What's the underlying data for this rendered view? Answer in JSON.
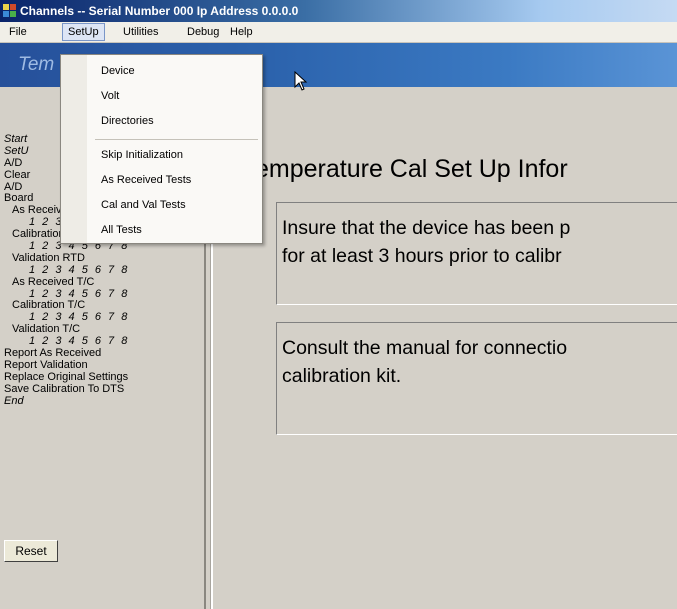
{
  "window": {
    "title": "Channels -- Serial Number 000  Ip Address 0.0.0.0"
  },
  "menubar": {
    "items": [
      "File",
      "SetUp",
      "Utilities",
      "Debug",
      "Help"
    ],
    "active": "SetUp"
  },
  "setup_menu": {
    "items": [
      "Device",
      "Volt",
      "Directories",
      "Skip Initialization",
      "As Received Tests",
      "Cal and Val Tests",
      "All Tests"
    ]
  },
  "banner": {
    "text": "Tem"
  },
  "sidebar": {
    "items": [
      "Start",
      "SetU",
      "A/D",
      "Clear",
      "A/D",
      "Board",
      "As Received RTD",
      "1 2 3 4 5 6 7 8",
      "Calibration RTD",
      "1 2 3 4 5 6 7 8",
      "Validation RTD",
      "1 2 3 4 5 6 7 8",
      "As Received T/C",
      "1 2 3 4 5 6 7 8",
      "Calibration T/C",
      "1 2 3 4 5 6 7 8",
      "Validation T/C",
      "1 2 3 4 5 6 7 8",
      "Report As Received",
      "Report Validation",
      "Replace Original Settings",
      "Save Calibration To DTS",
      "End"
    ],
    "reset_label": "Reset"
  },
  "main": {
    "heading": "emperature Cal Set Up Infor",
    "box1": {
      "line1": "Insure that the device has been p",
      "line2": "for at least 3 hours prior to calibr"
    },
    "box2": {
      "line1": "Consult the manual for connectio",
      "line2": "calibration kit."
    }
  }
}
